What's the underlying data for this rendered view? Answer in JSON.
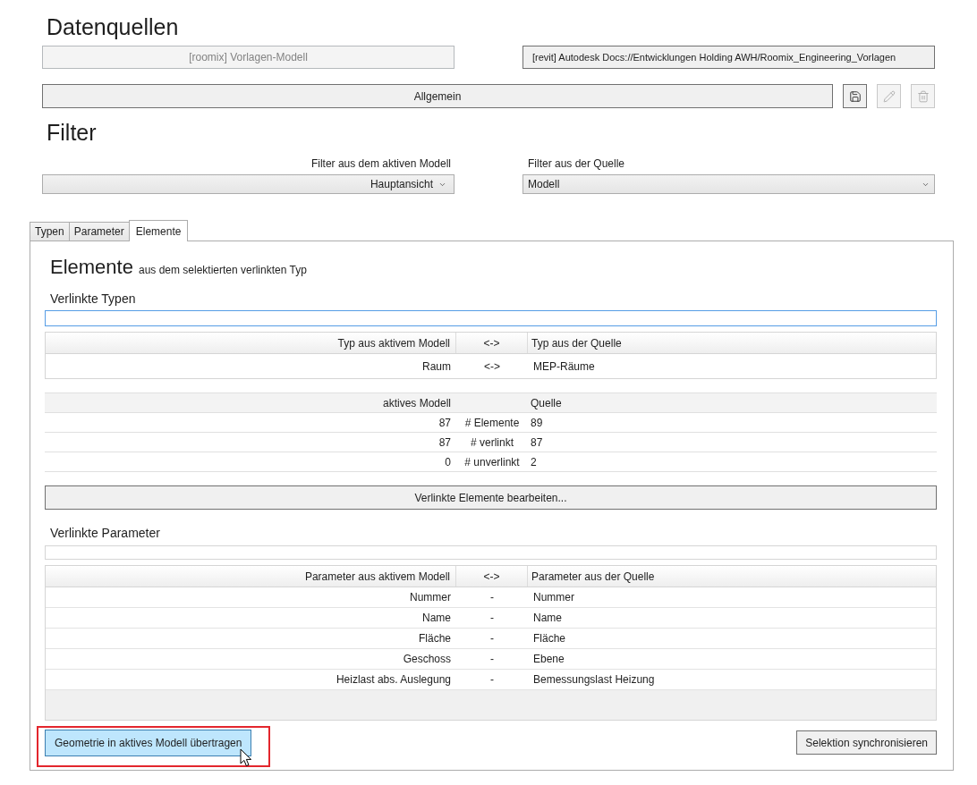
{
  "data_sources": {
    "title": "Datenquellen",
    "active_model": {
      "label": "[roomix] Vorlagen-Modell",
      "disabled": true
    },
    "source_model": {
      "label": "[revit] Autodesk Docs://Entwicklungen Holding AWH/Roomix_Engineering_Vorlagen",
      "disabled": false
    }
  },
  "profile": {
    "label": "Allgemein",
    "actions": [
      {
        "kind": "save",
        "disabled": false
      },
      {
        "kind": "edit",
        "disabled": true
      },
      {
        "kind": "delete",
        "disabled": true
      }
    ]
  },
  "filter": {
    "title": "Filter",
    "active": {
      "label": "Filter aus dem aktiven Modell",
      "value": "Hauptansicht"
    },
    "source": {
      "label": "Filter aus der Quelle",
      "value": "Modell"
    }
  },
  "tabs": [
    {
      "label": "Typen",
      "selected": false
    },
    {
      "label": "Parameter",
      "selected": false
    },
    {
      "label": "Elemente",
      "selected": true
    }
  ],
  "panel": {
    "title": "Elemente",
    "subtitle": "aus dem selektierten verlinkten Typ",
    "linked_types": {
      "title": "Verlinkte Typen",
      "search": {
        "focused": true
      },
      "columns": [
        "Typ aus aktivem Modell",
        "<->",
        "Typ aus der Quelle"
      ],
      "rows": [
        {
          "active": "Raum",
          "link": "<->",
          "source": "MEP-Räume"
        }
      ]
    },
    "counts": {
      "header": {
        "active": "aktives Modell",
        "source": "Quelle"
      },
      "rows": [
        {
          "active": "87",
          "label": "# Elemente",
          "source": "89"
        },
        {
          "active": "87",
          "label": "# verlinkt",
          "source": "87"
        },
        {
          "active": "0",
          "label": "# unverlinkt",
          "source": "2"
        }
      ]
    },
    "edit_button": {
      "label": "Verlinkte Elemente bearbeiten..."
    },
    "linked_parameters": {
      "title": "Verlinkte Parameter",
      "search": {
        "focused": false
      },
      "columns": [
        "Parameter aus aktivem Modell",
        "<->",
        "Parameter aus der Quelle"
      ],
      "rows": [
        {
          "active": "Nummer",
          "link": "-",
          "source": "Nummer"
        },
        {
          "active": "Name",
          "link": "-",
          "source": "Name"
        },
        {
          "active": "Fläche",
          "link": "-",
          "source": "Fläche"
        },
        {
          "active": "Geschoss",
          "link": "-",
          "source": "Ebene"
        },
        {
          "active": "Heizlast abs. Auslegung",
          "link": "-",
          "source": "Bemessungslast Heizung"
        }
      ]
    },
    "actions": [
      {
        "label": "Geometrie in aktives Modell übertragen",
        "hovered": true,
        "highlighted": true
      },
      {
        "label": "Selektion synchronisieren",
        "hovered": false,
        "highlighted": false
      }
    ]
  }
}
